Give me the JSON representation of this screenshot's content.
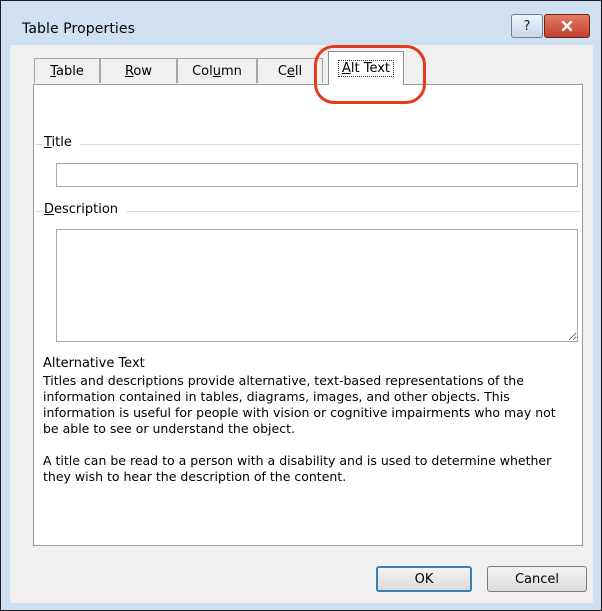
{
  "window": {
    "title": "Table Properties",
    "help_label": "?",
    "close_label": "✕"
  },
  "tabs": [
    {
      "label": "Table",
      "mnemonic": "T",
      "rest": "able"
    },
    {
      "label": "Row",
      "mnemonic": "R",
      "rest": "ow"
    },
    {
      "label": "Column",
      "prefix": "Col",
      "mnemonic": "u",
      "rest": "mn"
    },
    {
      "label": "Cell",
      "prefix": "C",
      "mnemonic": "e",
      "rest": "ll"
    },
    {
      "label": "Alt Text",
      "prefix": "",
      "mnemonic": "A",
      "rest": "lt Text",
      "active": true
    }
  ],
  "alt_text_panel": {
    "title_label_mnemonic": "T",
    "title_label_prefix": "",
    "title_label_rest": "itle",
    "title_label_full": "Title",
    "title_value": "",
    "description_label_mnemonic": "D",
    "description_label_rest": "escription",
    "description_label_full": "Description",
    "description_value": "",
    "help_heading": "Alternative Text",
    "help_paragraph_1": "Titles and descriptions provide alternative, text-based representations of the information contained in tables, diagrams, images, and other objects. This information is useful for people with vision or cognitive impairments who may not be able to see or understand the object.",
    "help_paragraph_2": "A title can be read to a person with a disability and is used to determine whether they wish to hear the description of the content."
  },
  "buttons": {
    "ok_label": "OK",
    "cancel_label": "Cancel"
  },
  "colors": {
    "annotation": "#e63a1e",
    "frame": "#cfe0f3",
    "close_button": "#c0412c"
  }
}
